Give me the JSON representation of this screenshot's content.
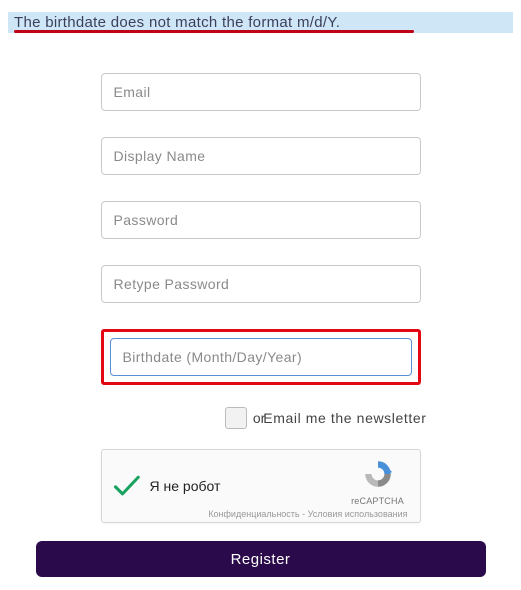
{
  "error": {
    "message": "The birthdate does not match the format m/d/Y."
  },
  "form": {
    "email_placeholder": "Email",
    "display_name_placeholder": "Display Name",
    "password_placeholder": "Password",
    "retype_password_placeholder": "Retype Password",
    "birthdate_placeholder": "Birthdate (Month/Day/Year)",
    "or_text": "or",
    "newsletter_label": "Email me the newsletter"
  },
  "recaptcha": {
    "label": "Я не робот",
    "brand": "reCAPTCHA",
    "footer": "Конфиденциальность - Условия использования"
  },
  "register_label": "Register"
}
